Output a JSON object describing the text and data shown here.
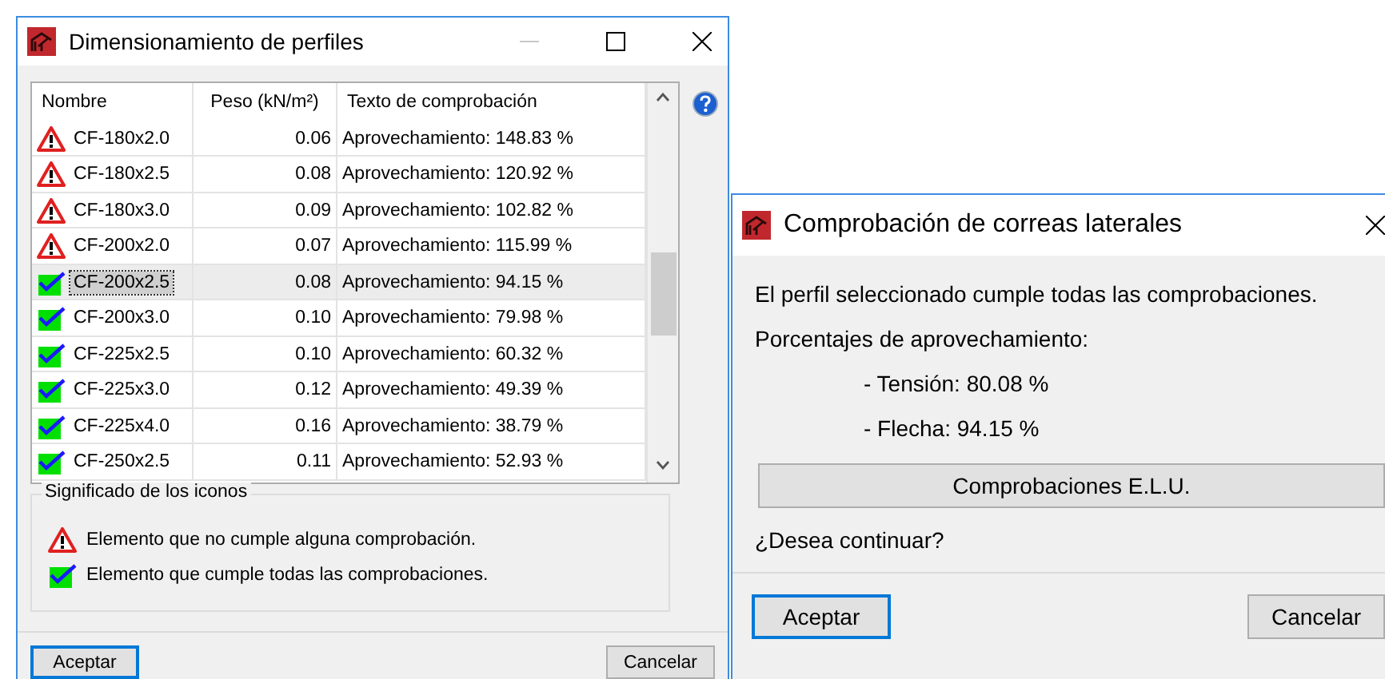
{
  "profiles_window": {
    "title": "Dimensionamiento de perfiles",
    "columns": [
      "Nombre",
      "Peso (kN/m²)",
      "Texto de comprobación"
    ],
    "rows": [
      {
        "passes": false,
        "name": "CF-180x2.0",
        "weight": "0.06",
        "check": "Aprovechamiento: 148.83 %",
        "selected": false
      },
      {
        "passes": false,
        "name": "CF-180x2.5",
        "weight": "0.08",
        "check": "Aprovechamiento: 120.92 %",
        "selected": false
      },
      {
        "passes": false,
        "name": "CF-180x3.0",
        "weight": "0.09",
        "check": "Aprovechamiento: 102.82 %",
        "selected": false
      },
      {
        "passes": false,
        "name": "CF-200x2.0",
        "weight": "0.07",
        "check": "Aprovechamiento: 115.99 %",
        "selected": false
      },
      {
        "passes": true,
        "name": "CF-200x2.5",
        "weight": "0.08",
        "check": "Aprovechamiento: 94.15 %",
        "selected": true
      },
      {
        "passes": true,
        "name": "CF-200x3.0",
        "weight": "0.10",
        "check": "Aprovechamiento: 79.98 %",
        "selected": false
      },
      {
        "passes": true,
        "name": "CF-225x2.5",
        "weight": "0.10",
        "check": "Aprovechamiento: 60.32 %",
        "selected": false
      },
      {
        "passes": true,
        "name": "CF-225x3.0",
        "weight": "0.12",
        "check": "Aprovechamiento: 49.39 %",
        "selected": false
      },
      {
        "passes": true,
        "name": "CF-225x4.0",
        "weight": "0.16",
        "check": "Aprovechamiento: 38.79 %",
        "selected": false
      },
      {
        "passes": true,
        "name": "CF-250x2.5",
        "weight": "0.11",
        "check": "Aprovechamiento: 52.93 %",
        "selected": false
      }
    ],
    "legend": {
      "title": "Significado de los iconos",
      "items": [
        {
          "passes": false,
          "text": "Elemento que no cumple alguna comprobación."
        },
        {
          "passes": true,
          "text": "Elemento que cumple todas las comprobaciones."
        }
      ]
    },
    "buttons": [
      {
        "label": "Aceptar",
        "focused": true
      },
      {
        "label": "Cancelar",
        "focused": false
      }
    ]
  },
  "check_window": {
    "title": "Comprobación de correas laterales",
    "message": "El perfil seleccionado cumple todas las comprobaciones.",
    "subtitle": "Porcentajes de aprovechamiento:",
    "readings": [
      "- Tensión: 80.08 %",
      "- Flecha: 94.15 %"
    ],
    "elu_button": "Comprobaciones E.L.U.",
    "question": "¿Desea continuar?",
    "buttons": [
      {
        "label": "Aceptar",
        "focused": true
      },
      {
        "label": "Cancelar",
        "focused": false
      }
    ]
  }
}
